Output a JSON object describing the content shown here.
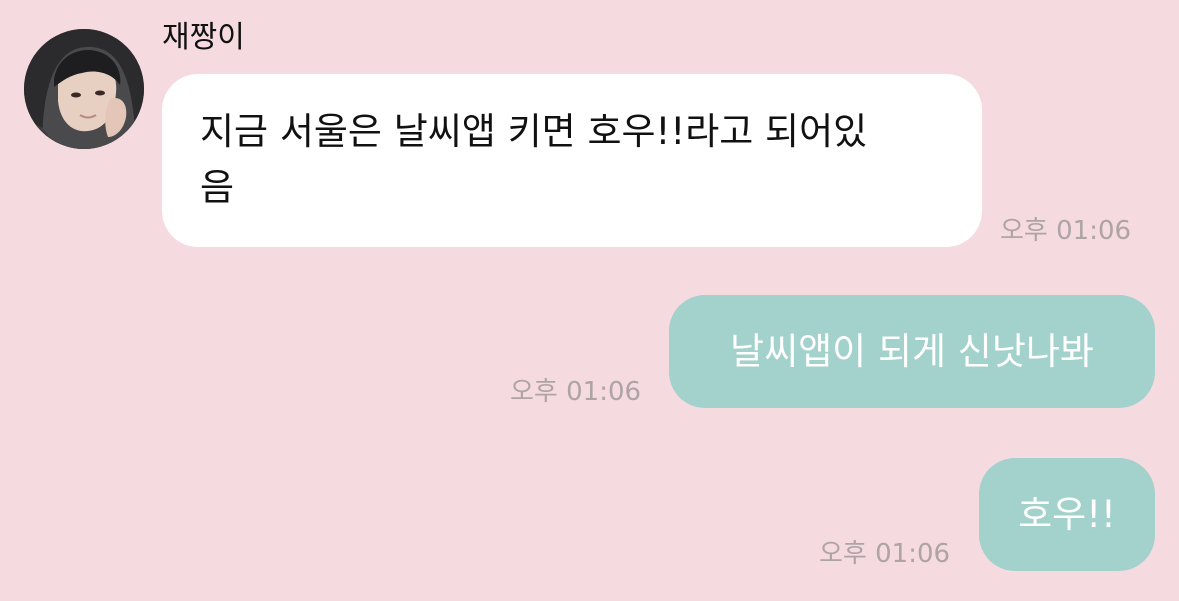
{
  "chat": {
    "sender_name": "재짱이",
    "avatar": "profile-photo",
    "messages": [
      {
        "direction": "incoming",
        "lines": [
          "지금 서울은 날씨앱 키면 호우!!라고 되어있",
          "음"
        ],
        "time": "오후 01:06"
      },
      {
        "direction": "outgoing",
        "text": "날씨앱이 되게 신낫나봐",
        "time": "오후 01:06"
      },
      {
        "direction": "outgoing",
        "text": "호우!!",
        "time": "오후 01:06"
      }
    ]
  },
  "colors": {
    "background": "#f5dbe0",
    "incoming_bubble": "#ffffff",
    "outgoing_bubble": "#a3d1cb",
    "timestamp": "#aea3a5"
  }
}
